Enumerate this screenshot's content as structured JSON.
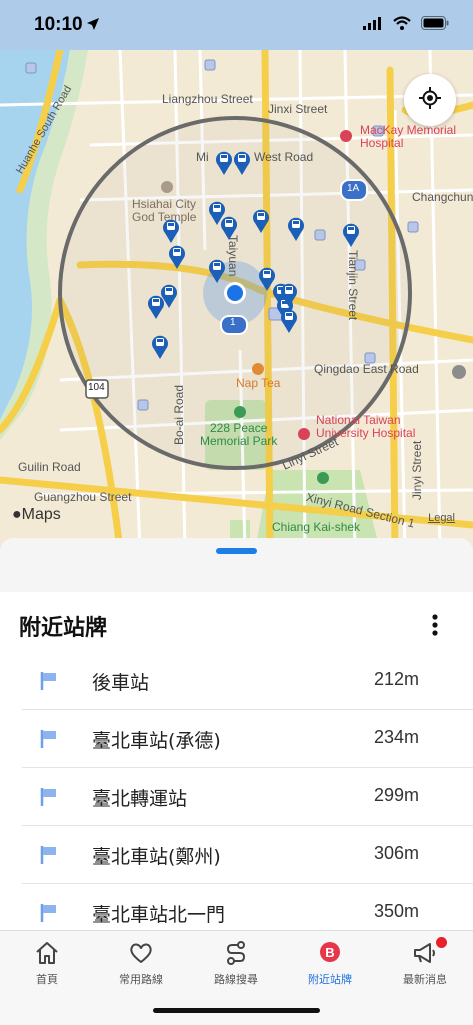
{
  "status": {
    "time": "10:10"
  },
  "map": {
    "labels": {
      "liangzhou": "Liangzhou Street",
      "jinxi": "Jinxi Street",
      "mackay": "MacKay Memorial\nHospital",
      "changchun": "Changchun",
      "minsheng": "Mi",
      "west_road": "West Road",
      "hsiahai": "Hsiahai City\nGod Temple",
      "taiyuan": "Taiyuan",
      "huanhe": "Huanhe South Road",
      "tianjin": "Tianjin Street",
      "route_1a": "1A",
      "route_1": "1",
      "route_104": "104",
      "qingdao": "Qingdao East Road",
      "nap_tea": "Nap Tea",
      "peace_park": "228 Peace\nMemorial Park",
      "ntuh": "National Taiwan\nUniversity Hospital",
      "guilin": "Guilin Road",
      "boai": "Bo-ai Road",
      "linyi": "Linyi Street",
      "jinyi": "Jinyi Street",
      "guangzhou": "Guangzhou Street",
      "xinyi": "Xinyi Road Section 1",
      "cks": "Chiang Kai-shek",
      "maps_brand": "Maps",
      "legal": "Legal"
    },
    "icons": {
      "locate": "locate-crosshair-icon",
      "bus_stop": "bus-stop-pin-icon"
    }
  },
  "sheet": {
    "title": "附近站牌",
    "more_icon": "more-vertical-icon",
    "stops": [
      {
        "name": "後車站",
        "distance": "212m"
      },
      {
        "name": "臺北車站(承德)",
        "distance": "234m"
      },
      {
        "name": "臺北轉運站",
        "distance": "299m"
      },
      {
        "name": "臺北車站(鄭州)",
        "distance": "306m"
      },
      {
        "name": "臺北車站北一門",
        "distance": "350m"
      }
    ]
  },
  "tabs": [
    {
      "label": "首頁",
      "icon": "home-icon"
    },
    {
      "label": "常用路線",
      "icon": "heart-icon"
    },
    {
      "label": "路線搜尋",
      "icon": "route-icon"
    },
    {
      "label": "附近站牌",
      "icon": "nearby-stop-icon",
      "active": true
    },
    {
      "label": "最新消息",
      "icon": "megaphone-icon",
      "badge": true
    }
  ],
  "colors": {
    "accent": "#1d6fe0",
    "map_road_major": "#f6cf4a",
    "water": "#a6d4ef",
    "badge": "#ea1f2d"
  }
}
